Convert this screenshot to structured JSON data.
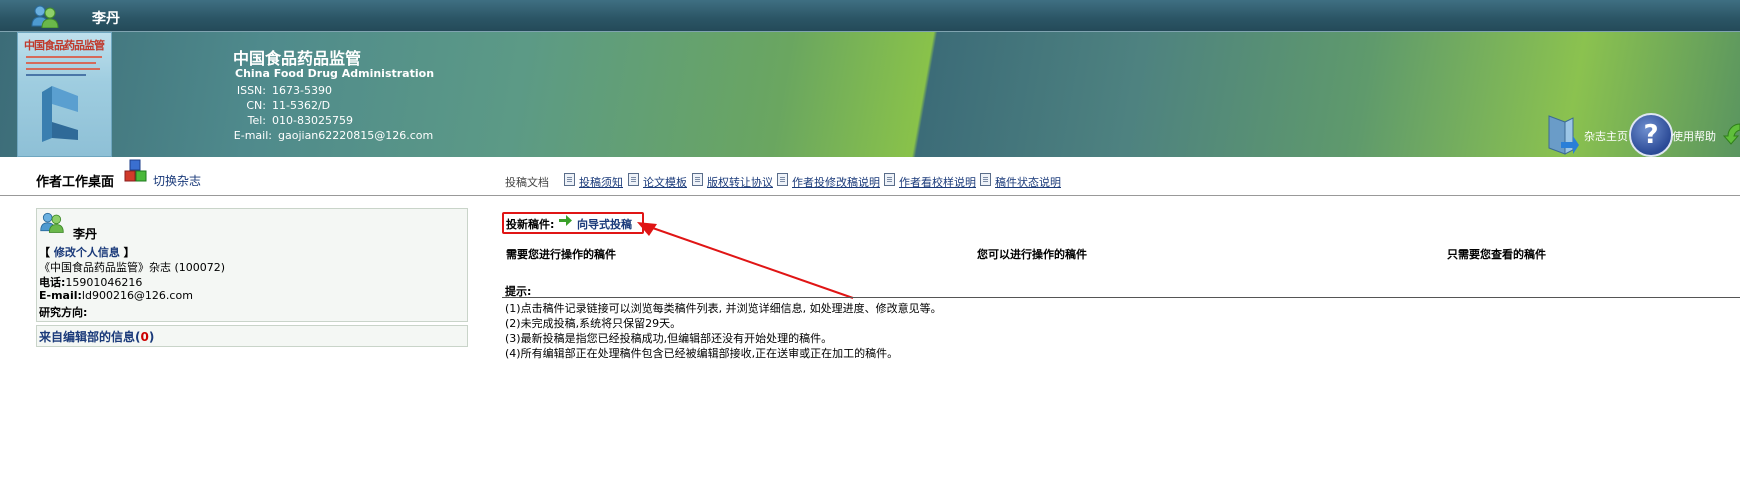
{
  "user": {
    "name": "李丹"
  },
  "journal": {
    "cover_title": "中国食品药品监管",
    "name_cn": "中国食品药品监管",
    "name_en": "China Food Drug Administration",
    "issn_label": "ISSN:",
    "issn": "1673-5390",
    "cn_label": "CN:",
    "cn": "11-5362/D",
    "tel_label": "Tel:",
    "tel": "010-83025759",
    "email_label": "E-mail:",
    "email": "gaojian62220815@126.com"
  },
  "header_links": {
    "home": "杂志主页",
    "help": "使用帮助",
    "help_glyph": "?"
  },
  "nav": {
    "desk_title": "作者工作桌面",
    "switch_journal": "切换杂志",
    "docs_label": "投稿文档",
    "items": [
      "投稿须知",
      "论文模板",
      "版权转让协议",
      "作者投修改稿说明",
      "作者看校样说明",
      "稿件状态说明"
    ]
  },
  "profile": {
    "name": "李丹",
    "edit_open": "【 ",
    "edit_link": "修改个人信息",
    "edit_close": " 】",
    "journal_line": "《中国食品药品监管》杂志 (100072)",
    "phone_label": "电话:",
    "phone": "15901046216",
    "email_label": "E-mail:",
    "email": "ld900216@126.com",
    "research_label": "研究方向:",
    "research": ""
  },
  "messages": {
    "label": "来自编辑部的信息(",
    "count": "0",
    "close": ")"
  },
  "submission": {
    "new_label": "投新稿件:",
    "wizard_link": "向导式投稿",
    "columns": [
      "需要您进行操作的稿件",
      "您可以进行操作的稿件",
      "只需要您查看的稿件"
    ],
    "tips_label": "提示:",
    "tips": [
      "(1)点击稿件记录链接可以浏览每类稿件列表, 并浏览详细信息, 如处理进度、修改意见等。",
      "(2)未完成投稿,系统将只保留29天。",
      "(3)最新投稿是指您已经投稿成功,但编辑部还没有开始处理的稿件。",
      "(4)所有编辑部正在处理稿件包含已经被编辑部接收,正在送审或正在加工的稿件。"
    ]
  },
  "colors": {
    "header_dark": "#2b5565",
    "link": "#1a3a7a",
    "highlight_red": "#e01515"
  }
}
